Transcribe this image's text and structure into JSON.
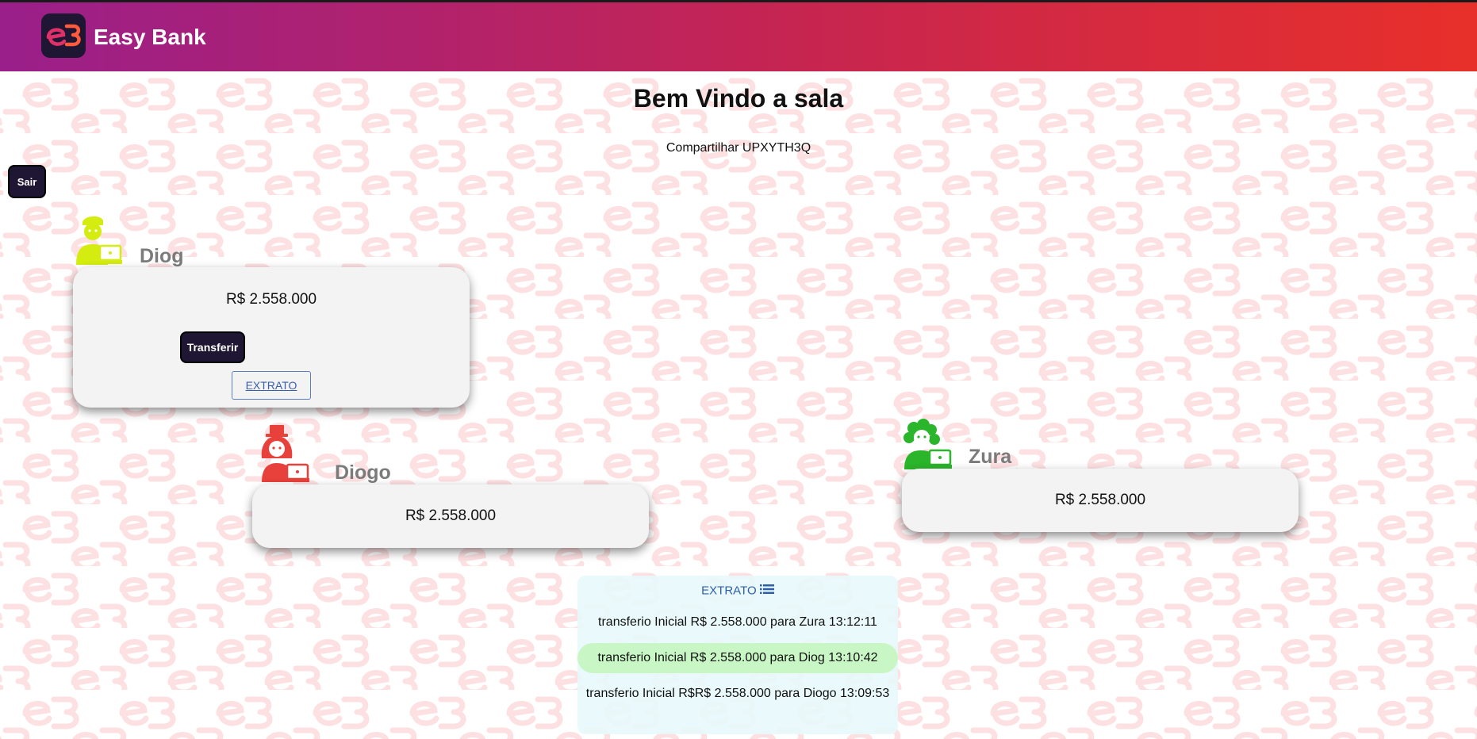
{
  "colors": {
    "header_gradient_start": "#9a1f8a",
    "header_gradient_mid": "#c72550",
    "header_gradient_end": "#e8302a",
    "dark_button": "#1e1632",
    "pattern_watermark": "#fde0e2",
    "statement_highlight": "#c8f7c5"
  },
  "header": {
    "logo_icon": "easy-bank-logo",
    "brand": "Easy Bank"
  },
  "room": {
    "welcome_title": "Bem Vindo a sala",
    "share_text": "Compartilhar UPXYTH3Q",
    "exit_button": "Sair"
  },
  "players": [
    {
      "name": "Diog",
      "avatar_icon": "man-at-laptop-icon",
      "avatar_color": "#d4ec10",
      "balance": "R$ 2.558.000",
      "transfer_button": "Transferir",
      "extrato_link": "EXTRATO"
    },
    {
      "name": "Diogo",
      "avatar_icon": "woman-top-hat-laptop-icon",
      "avatar_color": "#e8403a",
      "balance": "R$ 2.558.000"
    },
    {
      "name": "Zura",
      "avatar_icon": "woman-curly-hair-laptop-icon",
      "avatar_color": "#2ab52a",
      "balance": "R$ 2.558.000"
    }
  ],
  "statement": {
    "title": "EXTRATO",
    "title_icon": "list-icon",
    "entries": [
      "transferio Inicial R$ 2.558.000 para Zura 13:12:11",
      "transferio Inicial R$ 2.558.000 para Diog 13:10:42",
      "transferio Inicial R$R$ 2.558.000 para Diogo 13:09:53"
    ],
    "highlighted_index": 1
  }
}
